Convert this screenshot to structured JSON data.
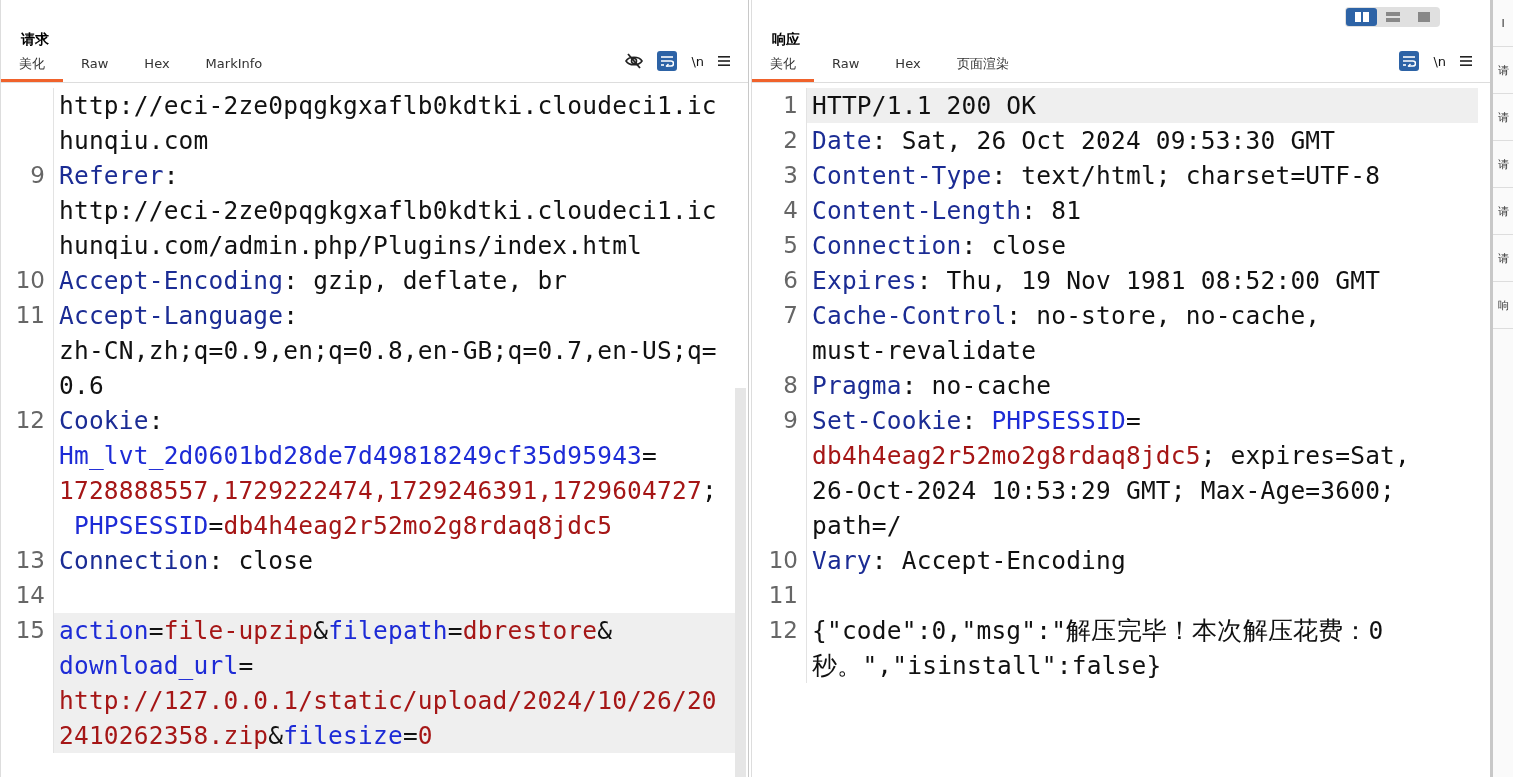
{
  "layout_toggle": [
    {
      "selected": true
    },
    {
      "selected": false
    },
    {
      "selected": false
    }
  ],
  "request": {
    "title": "请求",
    "tabs": [
      {
        "label": "美化",
        "selected": true
      },
      {
        "label": "Raw",
        "selected": false
      },
      {
        "label": "Hex",
        "selected": false
      },
      {
        "label": "MarkInfo",
        "selected": false
      }
    ],
    "tools": {
      "hide_toggle": true,
      "wrap_on": true,
      "newline_label": "\\n"
    },
    "lines": [
      {
        "current": false,
        "rows": [
          {
            "parts": [
              {
                "kind": "plain",
                "text": "http://eci-2ze0pqgkgxaflb0kdtki.cloudeci1.ic"
              }
            ]
          },
          {
            "parts": [
              {
                "kind": "plain",
                "text": "hunqiu.com"
              }
            ]
          }
        ]
      },
      {
        "number": "9",
        "current": false,
        "rows": [
          {
            "parts": [
              {
                "kind": "key",
                "text": "Referer"
              },
              {
                "kind": "plain",
                "text": ":"
              }
            ]
          },
          {
            "parts": [
              {
                "kind": "plain",
                "text": "http://eci-2ze0pqgkgxaflb0kdtki.cloudeci1.ic"
              }
            ]
          },
          {
            "parts": [
              {
                "kind": "plain",
                "text": "hunqiu.com/admin.php/Plugins/index.html"
              }
            ]
          }
        ]
      },
      {
        "number": "10",
        "current": false,
        "rows": [
          {
            "parts": [
              {
                "kind": "key",
                "text": "Accept-Encoding"
              },
              {
                "kind": "plain",
                "text": ": gzip, deflate, br"
              }
            ]
          }
        ]
      },
      {
        "number": "11",
        "current": false,
        "rows": [
          {
            "parts": [
              {
                "kind": "key",
                "text": "Accept-Language"
              },
              {
                "kind": "plain",
                "text": ":"
              }
            ]
          },
          {
            "parts": [
              {
                "kind": "plain",
                "text": "zh-CN,zh;q=0.9,en;q=0.8,en-GB;q=0.7,en-US;q="
              }
            ]
          },
          {
            "parts": [
              {
                "kind": "plain",
                "text": "0.6"
              }
            ]
          }
        ]
      },
      {
        "number": "12",
        "current": false,
        "rows": [
          {
            "parts": [
              {
                "kind": "key",
                "text": "Cookie"
              },
              {
                "kind": "plain",
                "text": ":"
              }
            ]
          },
          {
            "parts": [
              {
                "kind": "name",
                "text": "Hm_lvt_2d0601bd28de7d49818249cf35d95943"
              },
              {
                "kind": "plain",
                "text": "="
              }
            ]
          },
          {
            "parts": [
              {
                "kind": "value",
                "text": "1728888557,1729222474,1729246391,1729604727"
              },
              {
                "kind": "plain",
                "text": ";"
              }
            ]
          },
          {
            "parts": [
              {
                "kind": "name",
                "text": " PHPSESSID"
              },
              {
                "kind": "plain",
                "text": "="
              },
              {
                "kind": "value",
                "text": "db4h4eag2r52mo2g8rdaq8jdc5"
              }
            ]
          }
        ]
      },
      {
        "number": "13",
        "current": false,
        "rows": [
          {
            "parts": [
              {
                "kind": "key",
                "text": "Connection"
              },
              {
                "kind": "plain",
                "text": ": close"
              }
            ]
          }
        ]
      },
      {
        "number": "14",
        "current": false
      },
      {
        "number": "15",
        "current": true,
        "rows": [
          {
            "parts": [
              {
                "kind": "name",
                "text": "action"
              },
              {
                "kind": "plain",
                "text": "="
              },
              {
                "kind": "value",
                "text": "file-upzip"
              },
              {
                "kind": "plain",
                "text": "&"
              },
              {
                "kind": "name",
                "text": "filepath"
              },
              {
                "kind": "plain",
                "text": "="
              },
              {
                "kind": "value",
                "text": "dbrestore"
              },
              {
                "kind": "plain",
                "text": "&"
              }
            ]
          },
          {
            "parts": [
              {
                "kind": "name",
                "text": "download_url"
              },
              {
                "kind": "plain",
                "text": "="
              }
            ]
          },
          {
            "parts": [
              {
                "kind": "value",
                "text": "http://127.0.0.1/static/upload/2024/10/26/20"
              }
            ]
          },
          {
            "parts": [
              {
                "kind": "value",
                "text": "2410262358.zip"
              },
              {
                "kind": "plain",
                "text": "&"
              },
              {
                "kind": "name",
                "text": "filesize"
              },
              {
                "kind": "plain",
                "text": "="
              },
              {
                "kind": "value",
                "text": "0"
              }
            ]
          }
        ]
      }
    ]
  },
  "response": {
    "title": "响应",
    "tabs": [
      {
        "label": "美化",
        "selected": true
      },
      {
        "label": "Raw",
        "selected": false
      },
      {
        "label": "Hex",
        "selected": false
      },
      {
        "label": "页面渲染",
        "selected": false
      }
    ],
    "tools": {
      "wrap_on": true,
      "newline_label": "\\n"
    },
    "lines": [
      {
        "number": "1",
        "current": true,
        "rows": [
          {
            "parts": [
              {
                "kind": "plain",
                "text": "HTTP/1.1 200 OK"
              }
            ]
          }
        ]
      },
      {
        "number": "2",
        "current": false,
        "rows": [
          {
            "parts": [
              {
                "kind": "key",
                "text": "Date"
              },
              {
                "kind": "plain",
                "text": ": Sat, 26 Oct 2024 09:53:30 GMT"
              }
            ]
          }
        ]
      },
      {
        "number": "3",
        "current": false,
        "rows": [
          {
            "parts": [
              {
                "kind": "key",
                "text": "Content-Type"
              },
              {
                "kind": "plain",
                "text": ": text/html; charset=UTF-8"
              }
            ]
          }
        ]
      },
      {
        "number": "4",
        "current": false,
        "rows": [
          {
            "parts": [
              {
                "kind": "key",
                "text": "Content-Length"
              },
              {
                "kind": "plain",
                "text": ": 81"
              }
            ]
          }
        ]
      },
      {
        "number": "5",
        "current": false,
        "rows": [
          {
            "parts": [
              {
                "kind": "key",
                "text": "Connection"
              },
              {
                "kind": "plain",
                "text": ": close"
              }
            ]
          }
        ]
      },
      {
        "number": "6",
        "current": false,
        "rows": [
          {
            "parts": [
              {
                "kind": "key",
                "text": "Expires"
              },
              {
                "kind": "plain",
                "text": ": Thu, 19 Nov 1981 08:52:00 GMT"
              }
            ]
          }
        ]
      },
      {
        "number": "7",
        "current": false,
        "rows": [
          {
            "parts": [
              {
                "kind": "key",
                "text": "Cache-Control"
              },
              {
                "kind": "plain",
                "text": ": no-store, no-cache,"
              }
            ]
          },
          {
            "parts": [
              {
                "kind": "plain",
                "text": "must-revalidate"
              }
            ]
          }
        ]
      },
      {
        "number": "8",
        "current": false,
        "rows": [
          {
            "parts": [
              {
                "kind": "key",
                "text": "Pragma"
              },
              {
                "kind": "plain",
                "text": ": no-cache"
              }
            ]
          }
        ]
      },
      {
        "number": "9",
        "current": false,
        "rows": [
          {
            "parts": [
              {
                "kind": "key",
                "text": "Set-Cookie"
              },
              {
                "kind": "plain",
                "text": ": "
              },
              {
                "kind": "name",
                "text": "PHPSESSID"
              },
              {
                "kind": "plain",
                "text": "="
              }
            ]
          },
          {
            "parts": [
              {
                "kind": "value",
                "text": "db4h4eag2r52mo2g8rdaq8jdc5"
              },
              {
                "kind": "plain",
                "text": "; expires=Sat,"
              }
            ]
          },
          {
            "parts": [
              {
                "kind": "plain",
                "text": "26-Oct-2024 10:53:29 GMT; Max-Age=3600;"
              }
            ]
          },
          {
            "parts": [
              {
                "kind": "plain",
                "text": "path=/"
              }
            ]
          }
        ]
      },
      {
        "number": "10",
        "current": false,
        "rows": [
          {
            "parts": [
              {
                "kind": "key",
                "text": "Vary"
              },
              {
                "kind": "plain",
                "text": ": Accept-Encoding"
              }
            ]
          }
        ]
      },
      {
        "number": "11",
        "current": false
      },
      {
        "number": "12",
        "current": false,
        "rows": [
          {
            "parts": [
              {
                "kind": "plain",
                "text": "{\"code\":0,\"msg\":\"解压完毕！本次解压花费：0"
              }
            ]
          },
          {
            "parts": [
              {
                "kind": "plain",
                "text": "秒。\",\"isinstall\":false}"
              }
            ]
          }
        ]
      }
    ]
  },
  "side_tabs": [
    "I",
    "请",
    "请",
    "请",
    "请",
    "请",
    "响"
  ]
}
